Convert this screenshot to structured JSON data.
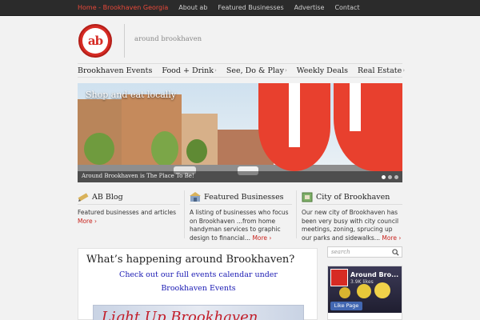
{
  "topnav": [
    {
      "label": "Home - Brookhaven Georgia",
      "active": true
    },
    {
      "label": "About ab"
    },
    {
      "label": "Featured Businesses"
    },
    {
      "label": "Advertise"
    },
    {
      "label": "Contact"
    }
  ],
  "header": {
    "logo": "ab",
    "tagline": "around brookhaven"
  },
  "mainnav": [
    {
      "label": "Brookhaven Events",
      "has_sub": false
    },
    {
      "label": "Food + Drink",
      "has_sub": true
    },
    {
      "label": "See, Do & Play",
      "has_sub": true
    },
    {
      "label": "Weekly Deals",
      "has_sub": false
    },
    {
      "label": "Real Estate",
      "has_sub": true
    }
  ],
  "slider": {
    "title": "Shop and eat locally",
    "caption": "Around Brookhaven is The Place To Be!",
    "slides": 3,
    "active_slide": 1
  },
  "features": [
    {
      "icon": "pencil-icon",
      "title": "AB Blog",
      "text": "Featured businesses and articles",
      "more": "More"
    },
    {
      "icon": "store-icon",
      "title": "Featured Businesses",
      "text": "A listing of businesses who focus on Brookhaven ...from home handyman services to graphic design to financial...",
      "more": "More"
    },
    {
      "icon": "map-icon",
      "title": "City of Brookhaven",
      "text": "Our new city of Brookhaven has been very busy with city council meetings, zoning, sprucing up our parks and sidewalks...",
      "more": "More"
    }
  ],
  "content": {
    "heading": "What’s happening around Brookhaven?",
    "link1": "Check out our full events calendar under",
    "link2": "Brookhaven Events",
    "banner": "Light Up Brookhaven"
  },
  "sidebar": {
    "search_placeholder": "search",
    "fb_name": "Around Bro...",
    "fb_likes": "3.9K likes",
    "fb_like_button": "Like Page"
  },
  "colors": {
    "accent": "#d62b24",
    "link": "#1a1ab3",
    "topbar": "#2b2b2b"
  }
}
